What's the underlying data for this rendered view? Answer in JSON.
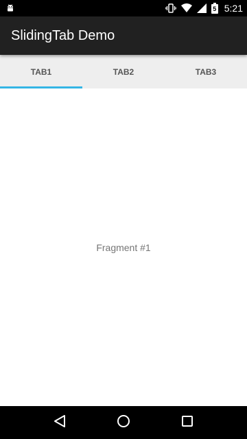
{
  "status_bar": {
    "time": "5:21",
    "battery_level": "5",
    "icons": [
      "android-icon",
      "vibrate-icon",
      "wifi-icon",
      "cell-signal-icon",
      "battery-icon"
    ]
  },
  "app_bar": {
    "title": "SlidingTab Demo",
    "background": "#212121"
  },
  "tabs": {
    "items": [
      {
        "label": "TAB1",
        "selected": true
      },
      {
        "label": "TAB2",
        "selected": false
      },
      {
        "label": "TAB3",
        "selected": false
      }
    ],
    "indicator_color": "#33b5e5"
  },
  "content": {
    "text": "Fragment #1"
  },
  "nav_bar": {
    "icons": [
      "back-icon",
      "home-icon",
      "recents-icon"
    ]
  }
}
